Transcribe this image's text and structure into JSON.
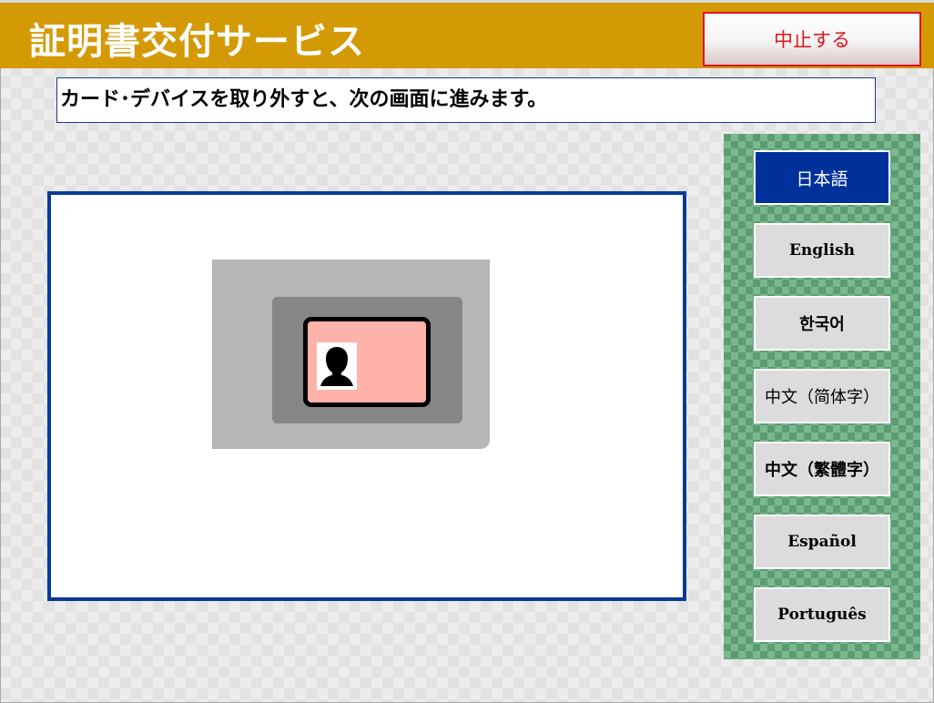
{
  "header": {
    "title": "証明書交付サービス",
    "cancel_label": "中止する",
    "colors": {
      "background": "#d49a06",
      "title": "#ffffff",
      "cancel_text": "#e0141e"
    }
  },
  "instruction": {
    "text": "カード･デバイスを取り外すと、次の画面に進みます。"
  },
  "illustration": {
    "icons": [
      "card-reader-icon",
      "id-card-icon",
      "person-silhouette-icon"
    ],
    "colors": {
      "reader": "#b6b6b6",
      "slot": "#868686",
      "card": "#ffb2aa",
      "border": "#0a3a96"
    }
  },
  "languages": {
    "selected": "日本語",
    "items": [
      {
        "label": "日本語"
      },
      {
        "label": "English"
      },
      {
        "label": "한국어"
      },
      {
        "label": "中文（简体字）"
      },
      {
        "label": "中文（繁體字）"
      },
      {
        "label": "Español"
      },
      {
        "label": "Português"
      }
    ],
    "colors": {
      "selected_bg": "#00319a",
      "button_bg": "#dcdcdc",
      "panel": "#5c9c72"
    }
  }
}
